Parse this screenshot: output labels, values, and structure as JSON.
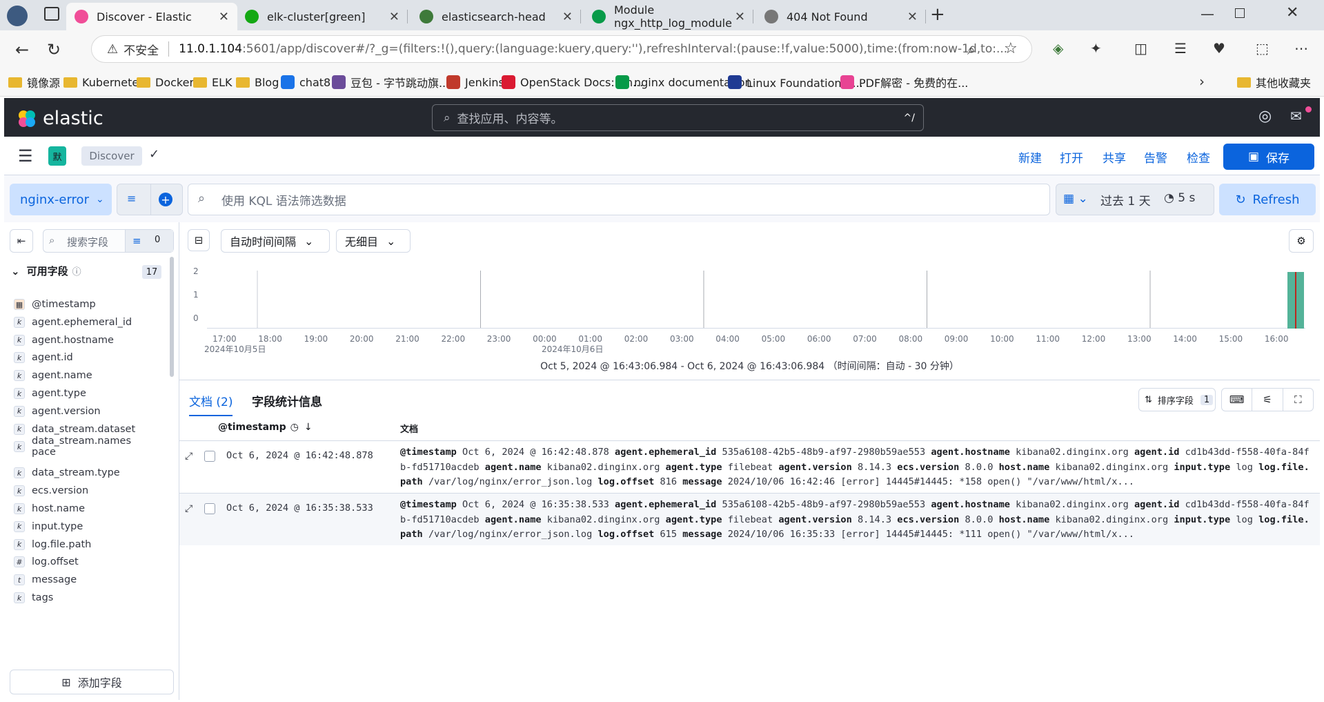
{
  "browser": {
    "tabs": [
      {
        "title": "Discover - Elastic",
        "active": true,
        "color": "#f04e98"
      },
      {
        "title": "elk-cluster[green]",
        "active": false,
        "color": "#14a814"
      },
      {
        "title": "elasticsearch-head",
        "active": false,
        "color": "#3e7a3a"
      },
      {
        "title": "Module ngx_http_log_module",
        "active": false,
        "color": "#079a48"
      },
      {
        "title": "404 Not Found",
        "active": false,
        "color": "#777777"
      }
    ],
    "security_label": "不安全",
    "url_host": "11.0.1.104",
    "url_rest": ":5601/app/discover#/?_g=(filters:!(),query:(language:kuery,query:''),refreshInterval:(pause:!f,value:5000),time:(from:now-1d,to:...",
    "bookmarks": [
      {
        "label": "镜像源",
        "kind": "folder"
      },
      {
        "label": "Kubernetes",
        "kind": "folder"
      },
      {
        "label": "Docker",
        "kind": "folder"
      },
      {
        "label": "ELK",
        "kind": "folder"
      },
      {
        "label": "Blog",
        "kind": "folder"
      },
      {
        "label": "chat8",
        "kind": "site",
        "color": "#1a73e8"
      },
      {
        "label": "豆包 - 字节跳动旗...",
        "kind": "site",
        "color": "#6b4c9a"
      },
      {
        "label": "Jenkins",
        "kind": "site",
        "color": "#c0392b"
      },
      {
        "label": "OpenStack Docs: Ch...",
        "kind": "site",
        "color": "#da1a32"
      },
      {
        "label": "nginx documentation",
        "kind": "site",
        "color": "#079a48"
      },
      {
        "label": "Linux Foundation开...",
        "kind": "site",
        "color": "#1f3a93"
      },
      {
        "label": "PDF解密 - 免费的在...",
        "kind": "site",
        "color": "#e84393"
      }
    ],
    "other_bookmarks": "其他收藏夹"
  },
  "kibana": {
    "brand": "elastic",
    "search_placeholder": "查找应用、内容等。",
    "search_shortcut": "^/",
    "space_badge": "默",
    "breadcrumb": "Discover",
    "top_links": [
      "新建",
      "打开",
      "共享",
      "告警",
      "检查"
    ],
    "save_label": "保存",
    "data_view": "nginx-error",
    "kql_placeholder": "使用 KQL 语法筛选数据",
    "time_range": "过去 1 天",
    "refresh_interval": "5 s",
    "refresh_label": "Refresh",
    "field_search_placeholder": "搜索字段",
    "field_filter_count": "0",
    "available_fields_label": "可用字段",
    "available_fields_count": "17",
    "fields": [
      {
        "name": "@timestamp",
        "type": "date"
      },
      {
        "name": "agent.ephemeral_id",
        "type": "k"
      },
      {
        "name": "agent.hostname",
        "type": "k"
      },
      {
        "name": "agent.id",
        "type": "k"
      },
      {
        "name": "agent.name",
        "type": "k"
      },
      {
        "name": "agent.type",
        "type": "k"
      },
      {
        "name": "agent.version",
        "type": "k"
      },
      {
        "name": "data_stream.dataset",
        "type": "k"
      },
      {
        "name": "data_stream.names\npace",
        "type": "k"
      },
      {
        "name": "data_stream.type",
        "type": "k"
      },
      {
        "name": "ecs.version",
        "type": "k"
      },
      {
        "name": "host.name",
        "type": "k"
      },
      {
        "name": "input.type",
        "type": "k"
      },
      {
        "name": "log.file.path",
        "type": "k"
      },
      {
        "name": "log.offset",
        "type": "#"
      },
      {
        "name": "message",
        "type": "t"
      },
      {
        "name": "tags",
        "type": "k"
      }
    ],
    "add_field_label": "添加字段",
    "interval_select": "自动时间间隔",
    "breakdown_select": "无细目",
    "histogram": {
      "y_ticks": [
        "2",
        "1",
        "0"
      ],
      "x_ticks": [
        "17:00",
        "18:00",
        "19:00",
        "20:00",
        "21:00",
        "22:00",
        "23:00",
        "00:00",
        "01:00",
        "02:00",
        "03:00",
        "04:00",
        "05:00",
        "06:00",
        "07:00",
        "08:00",
        "09:00",
        "10:00",
        "11:00",
        "12:00",
        "13:00",
        "14:00",
        "15:00",
        "16:00"
      ],
      "date_labels": [
        "2024年10月5日",
        "2024年10月6日"
      ],
      "range_text": "Oct 5, 2024 @ 16:43:06.984 - Oct 6, 2024 @ 16:43:06.984 （时间间隔：自动 - 30 分钟）",
      "bar_color": "#54b399",
      "bar_value": 2
    },
    "doc_tab": "文档 (2)",
    "stats_tab": "字段统计信息",
    "sort_label": "排序字段",
    "sort_count": "1",
    "col_timestamp": "@timestamp",
    "col_document": "文档",
    "rows": [
      {
        "timestamp": "Oct 6, 2024 @ 16:42:48.878",
        "pairs": [
          [
            "@timestamp",
            "Oct 6, 2024 @ 16:42:48.878"
          ],
          [
            "agent.ephemeral_id",
            "535a6108-42b5-48b9-af97-2980b59ae553"
          ],
          [
            "agent.hostname",
            "kibana02.dinginx.org"
          ],
          [
            "agent.id",
            "cd1b43dd-f558-40fa-84fb-fd51710acdeb"
          ],
          [
            "agent.name",
            "kibana02.dinginx.org"
          ],
          [
            "agent.type",
            "filebeat"
          ],
          [
            "agent.version",
            "8.14.3"
          ],
          [
            "ecs.version",
            "8.0.0"
          ],
          [
            "host.name",
            "kibana02.dinginx.org"
          ],
          [
            "input.type",
            "log"
          ],
          [
            "log.file.path",
            "/var/log/nginx/error_json.log"
          ],
          [
            "log.offset",
            "816"
          ],
          [
            "message",
            "2024/10/06 16:42:46 [error] 14445#14445: *158 open() \"/var/www/html/x..."
          ]
        ]
      },
      {
        "timestamp": "Oct 6, 2024 @ 16:35:38.533",
        "pairs": [
          [
            "@timestamp",
            "Oct 6, 2024 @ 16:35:38.533"
          ],
          [
            "agent.ephemeral_id",
            "535a6108-42b5-48b9-af97-2980b59ae553"
          ],
          [
            "agent.hostname",
            "kibana02.dinginx.org"
          ],
          [
            "agent.id",
            "cd1b43dd-f558-40fa-84fb-fd51710acdeb"
          ],
          [
            "agent.name",
            "kibana02.dinginx.org"
          ],
          [
            "agent.type",
            "filebeat"
          ],
          [
            "agent.version",
            "8.14.3"
          ],
          [
            "ecs.version",
            "8.0.0"
          ],
          [
            "host.name",
            "kibana02.dinginx.org"
          ],
          [
            "input.type",
            "log"
          ],
          [
            "log.file.path",
            "/var/log/nginx/error_json.log"
          ],
          [
            "log.offset",
            "615"
          ],
          [
            "message",
            "2024/10/06 16:35:33 [error] 14445#14445: *111 open() \"/var/www/html/x..."
          ]
        ]
      }
    ]
  }
}
